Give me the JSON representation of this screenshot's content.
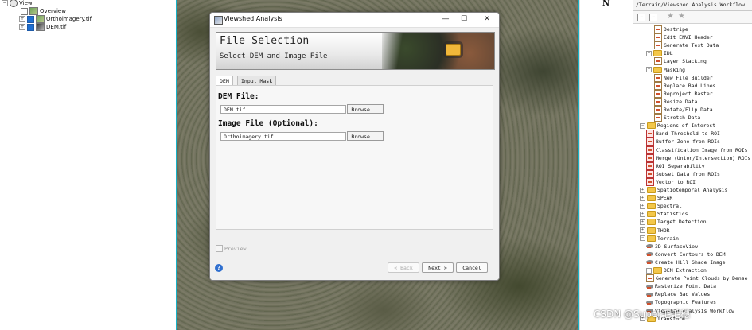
{
  "layer_tree": {
    "root_label": "View",
    "items": [
      {
        "label": "Overview",
        "checked": false
      },
      {
        "label": "Orthoimagery.tif",
        "checked": true
      },
      {
        "label": "DEM.tif",
        "checked": true
      }
    ]
  },
  "map": {
    "north_label": "N"
  },
  "dialog": {
    "title": "Viewshed Analysis",
    "banner_title": "File Selection",
    "banner_subtitle": "Select DEM and Image File",
    "tabs": [
      "DEM",
      "Input Mask"
    ],
    "dem_label": "DEM File:",
    "dem_value": "DEM.tif",
    "image_label": "Image File (Optional):",
    "image_value": "Orthoimagery.tif",
    "browse_label": "Browse...",
    "preview_label": "Preview",
    "back_label": "< Back",
    "next_label": "Next >",
    "cancel_label": "Cancel",
    "help_glyph": "?"
  },
  "window_controls": {
    "minimize": "—",
    "maximize": "☐",
    "close": "✕"
  },
  "toolbox": {
    "path": "/Terrain/Viewshed Analysis Workflow",
    "items": [
      {
        "label": "Destripe",
        "level": 2,
        "kind": "tool"
      },
      {
        "label": "Edit ENVI Header",
        "level": 2,
        "kind": "tool"
      },
      {
        "label": "Generate Test Data",
        "level": 2,
        "kind": "tool"
      },
      {
        "label": "IDL",
        "level": 1,
        "kind": "folder",
        "expander": "+"
      },
      {
        "label": "Layer Stacking",
        "level": 2,
        "kind": "tool"
      },
      {
        "label": "Masking",
        "level": 1,
        "kind": "folder",
        "expander": "+"
      },
      {
        "label": "New File Builder",
        "level": 2,
        "kind": "tool"
      },
      {
        "label": "Replace Bad Lines",
        "level": 2,
        "kind": "tool"
      },
      {
        "label": "Reproject Raster",
        "level": 2,
        "kind": "tool"
      },
      {
        "label": "Resize Data",
        "level": 2,
        "kind": "tool"
      },
      {
        "label": "Rotate/Flip Data",
        "level": 2,
        "kind": "tool"
      },
      {
        "label": "Stretch Data",
        "level": 2,
        "kind": "tool"
      },
      {
        "label": "Regions of Interest",
        "level": 0,
        "kind": "folder",
        "expander": "-"
      },
      {
        "label": "Band Threshold to ROI",
        "level": 1,
        "kind": "roi"
      },
      {
        "label": "Buffer Zone from ROIs",
        "level": 1,
        "kind": "roi"
      },
      {
        "label": "Classification Image from ROIs",
        "level": 1,
        "kind": "roi"
      },
      {
        "label": "Merge (Union/Intersection) ROIs",
        "level": 1,
        "kind": "roi"
      },
      {
        "label": "ROI Separability",
        "level": 1,
        "kind": "roi"
      },
      {
        "label": "Subset Data from ROIs",
        "level": 1,
        "kind": "roi"
      },
      {
        "label": "Vector to ROI",
        "level": 1,
        "kind": "roi"
      },
      {
        "label": "Spatiotemporal Analysis",
        "level": 0,
        "kind": "folder",
        "expander": "+"
      },
      {
        "label": "SPEAR",
        "level": 0,
        "kind": "folder",
        "expander": "+"
      },
      {
        "label": "Spectral",
        "level": 0,
        "kind": "folder",
        "expander": "+"
      },
      {
        "label": "Statistics",
        "level": 0,
        "kind": "folder",
        "expander": "+"
      },
      {
        "label": "Target Detection",
        "level": 0,
        "kind": "folder",
        "expander": "+"
      },
      {
        "label": "THOR",
        "level": 0,
        "kind": "folder",
        "expander": "+"
      },
      {
        "label": "Terrain",
        "level": 0,
        "kind": "folder",
        "expander": "-"
      },
      {
        "label": "3D SurfaceView",
        "level": 1,
        "kind": "terrain"
      },
      {
        "label": "Convert Contours to DEM",
        "level": 1,
        "kind": "terrain"
      },
      {
        "label": "Create Hill Shade Image",
        "level": 1,
        "kind": "terrain"
      },
      {
        "label": "DEM Extraction",
        "level": 1,
        "kind": "folder",
        "expander": "+"
      },
      {
        "label": "Generate Point Clouds by Dense",
        "level": 1,
        "kind": "tool"
      },
      {
        "label": "Rasterize Point Data",
        "level": 1,
        "kind": "terrain"
      },
      {
        "label": "Replace Bad Values",
        "level": 1,
        "kind": "terrain"
      },
      {
        "label": "Topographic Features",
        "level": 1,
        "kind": "terrain"
      },
      {
        "label": "Viewshed Analysis Workflow",
        "level": 1,
        "kind": "terrain"
      },
      {
        "label": "Transform",
        "level": 0,
        "kind": "folder",
        "expander": "+"
      }
    ]
  },
  "watermark": "CSDN @Super毛毛穗"
}
